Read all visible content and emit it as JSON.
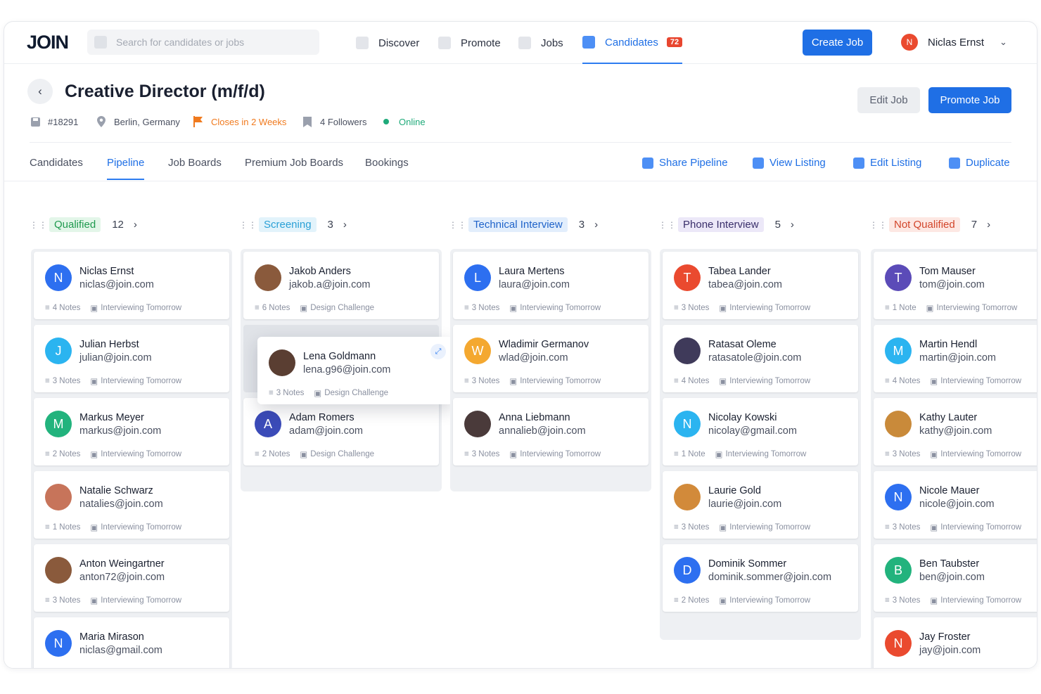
{
  "brand": {
    "logo": "JOIN"
  },
  "search": {
    "placeholder": "Search for candidates or jobs"
  },
  "nav": [
    {
      "label": "Discover"
    },
    {
      "label": "Promote"
    },
    {
      "label": "Jobs"
    },
    {
      "label": "Candidates",
      "badge": "72"
    }
  ],
  "topbar": {
    "create_job": "Create Job"
  },
  "user": {
    "initial": "N",
    "name": "Niclas Ernst"
  },
  "job": {
    "title": "Creative Director (m/f/d)",
    "id": "#18291",
    "location": "Berlin, Germany",
    "closes": "Closes in 2 Weeks",
    "followers": "4 Followers",
    "status": "Online",
    "edit": "Edit Job",
    "promote": "Promote Job"
  },
  "tabs": [
    {
      "label": "Candidates"
    },
    {
      "label": "Pipeline"
    },
    {
      "label": "Job Boards"
    },
    {
      "label": "Premium Job Boards"
    },
    {
      "label": "Bookings"
    }
  ],
  "actions": [
    {
      "label": "Share Pipeline"
    },
    {
      "label": "View Listing"
    },
    {
      "label": "Edit Listing"
    },
    {
      "label": "Duplicate"
    }
  ],
  "colors": {
    "accent": "#1f6fe5",
    "alert": "#e8462f",
    "online": "#1faa7a",
    "warning": "#f07a1e"
  },
  "columns": [
    {
      "stage": "Qualified",
      "count": "12",
      "stage_bg": "#e3f6e9",
      "stage_fg": "#1f9a4f",
      "cards": [
        {
          "initial": "N",
          "color": "#2d6ff0",
          "name": "Niclas Ernst",
          "email": "niclas@join.com",
          "notes": "4 Notes",
          "status": "Interviewing Tomorrow"
        },
        {
          "initial": "J",
          "color": "#2bb4f0",
          "name": "Julian Herbst",
          "email": "julian@join.com",
          "notes": "3 Notes",
          "status": "Interviewing Tomorrow"
        },
        {
          "initial": "M",
          "color": "#22b37d",
          "name": "Markus Meyer",
          "email": "markus@join.com",
          "notes": "2 Notes",
          "status": "Interviewing Tomorrow"
        },
        {
          "initial": "",
          "color": "#c7745a",
          "name": "Natalie Schwarz",
          "email": "natalies@join.com",
          "notes": "1 Notes",
          "status": "Interviewing Tomorrow"
        },
        {
          "initial": "",
          "color": "#8a5a3c",
          "name": "Anton Weingartner",
          "email": "anton72@join.com",
          "notes": "3 Notes",
          "status": "Interviewing Tomorrow"
        },
        {
          "initial": "N",
          "color": "#2d6ff0",
          "name": "Maria Mirason",
          "email": "niclas@gmail.com",
          "notes": "",
          "status": ""
        }
      ]
    },
    {
      "stage": "Screening",
      "count": "3",
      "stage_bg": "#e2f3fb",
      "stage_fg": "#2aa0d6",
      "cards": [
        {
          "initial": "",
          "color": "#8a5a3c",
          "name": "Jakob Anders",
          "email": "jakob.a@join.com",
          "notes": "6 Notes",
          "status": "Design Challenge"
        },
        {
          "initial": "A",
          "color": "#3b4bb8",
          "name": "Adam Romers",
          "email": "adam@join.com",
          "notes": "2 Notes",
          "status": "Design Challenge"
        }
      ],
      "dragging": {
        "initial": "",
        "color": "#5a3e32",
        "name": "Lena Goldmann",
        "email": "lena.g96@join.com",
        "notes": "3 Notes",
        "status": "Design Challenge"
      }
    },
    {
      "stage": "Technical Interview",
      "count": "3",
      "stage_bg": "#e2eefc",
      "stage_fg": "#1f63c9",
      "cards": [
        {
          "initial": "L",
          "color": "#2d6ff0",
          "name": "Laura Mertens",
          "email": "laura@join.com",
          "notes": "3 Notes",
          "status": "Interviewing Tomorrow"
        },
        {
          "initial": "W",
          "color": "#f4a830",
          "name": "Wladimir Germanov",
          "email": "wlad@join.com",
          "notes": "3 Notes",
          "status": "Interviewing Tomorrow"
        },
        {
          "initial": "",
          "color": "#4a3a3a",
          "name": "Anna Liebmann",
          "email": "annalieb@join.com",
          "notes": "3 Notes",
          "status": "Interviewing Tomorrow"
        }
      ]
    },
    {
      "stage": "Phone Interview",
      "count": "5",
      "stage_bg": "#ece8f8",
      "stage_fg": "#3a2f6b",
      "cards": [
        {
          "initial": "T",
          "color": "#ea4a2f",
          "name": "Tabea Lander",
          "email": "tabea@join.com",
          "notes": "3 Notes",
          "status": "Interviewing Tomorrow"
        },
        {
          "initial": "",
          "color": "#3f3a5a",
          "name": "Ratasat Oleme",
          "email": "ratasatole@join.com",
          "notes": "4 Notes",
          "status": "Interviewing Tomorrow"
        },
        {
          "initial": "N",
          "color": "#2bb4f0",
          "name": "Nicolay Kowski",
          "email": "nicolay@gmail.com",
          "notes": "1 Note",
          "status": "Interviewing Tomorrow"
        },
        {
          "initial": "",
          "color": "#d28a3a",
          "name": "Laurie Gold",
          "email": "laurie@join.com",
          "notes": "3 Notes",
          "status": "Interviewing Tomorrow"
        },
        {
          "initial": "D",
          "color": "#2d6ff0",
          "name": "Dominik Sommer",
          "email": "dominik.sommer@join.com",
          "notes": "2 Notes",
          "status": "Interviewing Tomorrow"
        }
      ]
    },
    {
      "stage": "Not Qualified",
      "count": "7",
      "stage_bg": "#fde8e3",
      "stage_fg": "#d2452a",
      "cards": [
        {
          "initial": "T",
          "color": "#5b4bb8",
          "name": "Tom Mauser",
          "email": "tom@join.com",
          "notes": "1 Note",
          "status": "Interviewing Tomorrow"
        },
        {
          "initial": "M",
          "color": "#2bb4f0",
          "name": "Martin Hendl",
          "email": "martin@join.com",
          "notes": "4 Notes",
          "status": "Interviewing Tomorrow"
        },
        {
          "initial": "",
          "color": "#c98a3a",
          "name": "Kathy Lauter",
          "email": "kathy@join.com",
          "notes": "3 Notes",
          "status": "Interviewing Tomorrow"
        },
        {
          "initial": "N",
          "color": "#2d6ff0",
          "name": "Nicole Mauer",
          "email": "nicole@join.com",
          "notes": "3 Notes",
          "status": "Interviewing Tomorrow"
        },
        {
          "initial": "B",
          "color": "#22b37d",
          "name": "Ben Taubster",
          "email": "ben@join.com",
          "notes": "3 Notes",
          "status": "Interviewing Tomorrow"
        },
        {
          "initial": "N",
          "color": "#ea4a2f",
          "name": "Jay Froster",
          "email": "jay@join.com",
          "notes": "",
          "status": ""
        }
      ]
    }
  ]
}
